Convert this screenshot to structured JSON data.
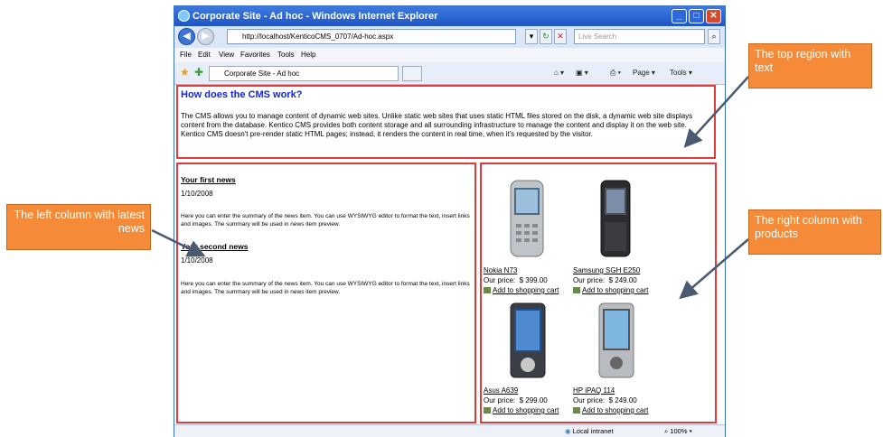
{
  "browser": {
    "title": "Corporate Site - Ad hoc - Windows Internet Explorer",
    "address": "http://localhost/KenticoCMS_0707/Ad-hoc.aspx",
    "search_placeholder": "Live Search",
    "menu": [
      "File",
      "Edit",
      "View",
      "Favorites",
      "Tools",
      "Help"
    ],
    "tab_label": "Corporate Site - Ad hoc",
    "tools": {
      "page": "Page",
      "tools": "Tools"
    },
    "status": {
      "zone": "Local intranet",
      "zoom": "100%"
    }
  },
  "top": {
    "heading": "How does the CMS work?",
    "text": "The CMS allows you to manage content of dynamic web sites. Unlike static web sites that uses static HTML files stored on the disk, a dynamic web site displays content from the database. Kentico CMS provides both content storage and all surrounding infrastructure to manage the content and display it on the web site. Kentico CMS doesn't pre-render static HTML pages; instead, it renders the content in real time, when it's requested by the visitor."
  },
  "news": [
    {
      "title": "Your first news",
      "date": "1/10/2008",
      "summary": "Here you can enter the summary of the news item. You can use WYSIWYG editor to format the text, insert links and images. The summary will be used in news item preview."
    },
    {
      "title": "Your second news",
      "date": "1/10/2008",
      "summary": "Here you can enter the summary of the news item. You can use WYSIWYG editor to format the text, insert links and images. The summary will be used in news item preview."
    }
  ],
  "products": [
    {
      "name": "Nokia N73",
      "price_label": "Our price:",
      "price": "$ 399.00",
      "cart": "Add to shopping cart"
    },
    {
      "name": "Samsung SGH E250",
      "price_label": "Our price:",
      "price": "$ 249.00",
      "cart": "Add to shopping cart"
    },
    {
      "name": "Asus A639",
      "price_label": "Our price:",
      "price": "$ 299.00",
      "cart": "Add to shopping cart"
    },
    {
      "name": "HP iPAQ 114",
      "price_label": "Our price:",
      "price": "$ 249.00",
      "cart": "Add to shopping cart"
    }
  ],
  "callouts": {
    "left": "The left column with latest news",
    "top": "The top region with text",
    "right": "The right column with products"
  },
  "colors": {
    "region_border": "#e23b3b",
    "callout": "#f58b39",
    "heading": "#1226d8"
  }
}
